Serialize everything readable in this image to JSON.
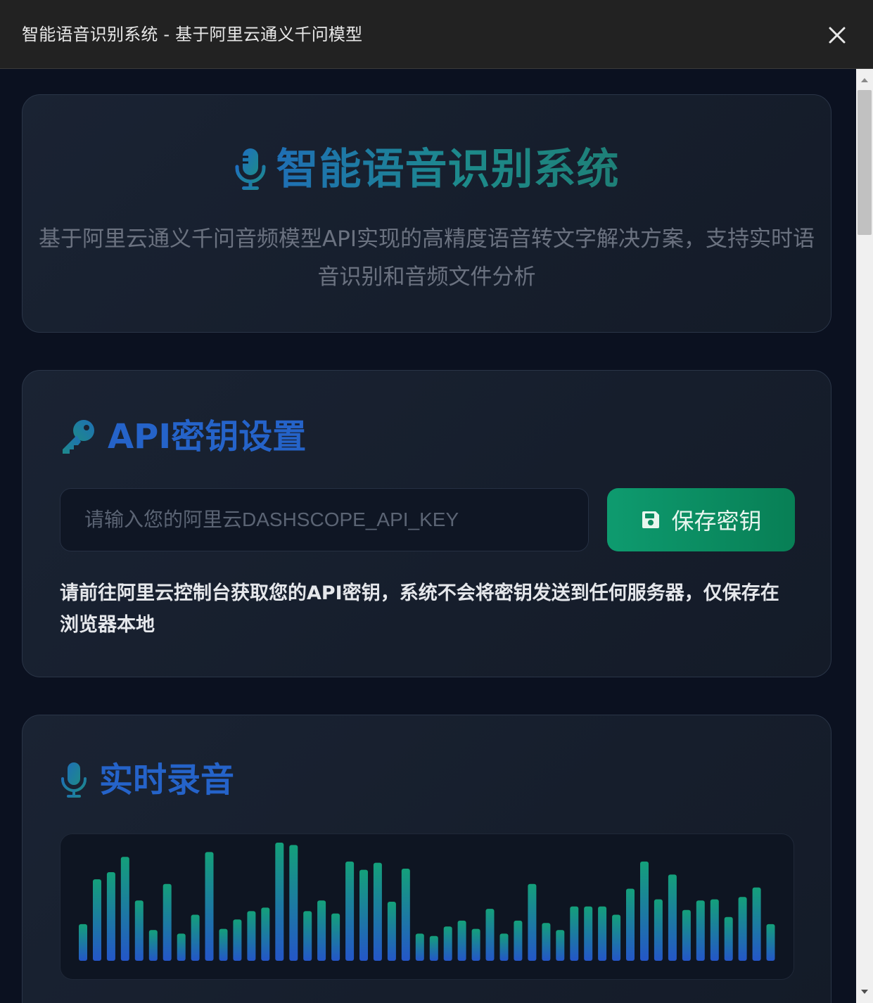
{
  "window": {
    "title": "智能语音识别系统 - 基于阿里云通义千问模型",
    "close_icon": "close-icon"
  },
  "hero": {
    "icon": "microphone-icon",
    "title": "智能语音识别系统",
    "subtitle": "基于阿里云通义千问音频模型API实现的高精度语音转文字解决方案，支持实时语音识别和音频文件分析"
  },
  "api_settings": {
    "icon": "key-icon",
    "title": "API密钥设置",
    "input_placeholder": "请输入您的阿里云DASHSCOPE_API_KEY",
    "input_value": "",
    "save_icon": "save-icon",
    "save_label": "保存密钥",
    "note": "请前往阿里云控制台获取您的API密钥，系统不会将密钥发送到任何服务器，仅保存在浏览器本地"
  },
  "recording": {
    "icon": "microphone-icon",
    "title": "实时录音",
    "waveform_levels": [
      0.31,
      0.69,
      0.75,
      0.88,
      0.51,
      0.26,
      0.65,
      0.23,
      0.39,
      0.92,
      0.27,
      0.35,
      0.42,
      0.45,
      1.0,
      0.98,
      0.42,
      0.51,
      0.4,
      0.84,
      0.77,
      0.83,
      0.5,
      0.78,
      0.23,
      0.21,
      0.29,
      0.34,
      0.27,
      0.44,
      0.23,
      0.34,
      0.65,
      0.32,
      0.26,
      0.46,
      0.46,
      0.46,
      0.39,
      0.61,
      0.84,
      0.52,
      0.73,
      0.43,
      0.51,
      0.52,
      0.37,
      0.54,
      0.62,
      0.31
    ]
  },
  "colors": {
    "background": "#0b1120",
    "card": "#1a2333",
    "accent_blue": "#2563c9",
    "accent_teal": "#1d8a8a",
    "save_green": "#0e9b6f"
  }
}
